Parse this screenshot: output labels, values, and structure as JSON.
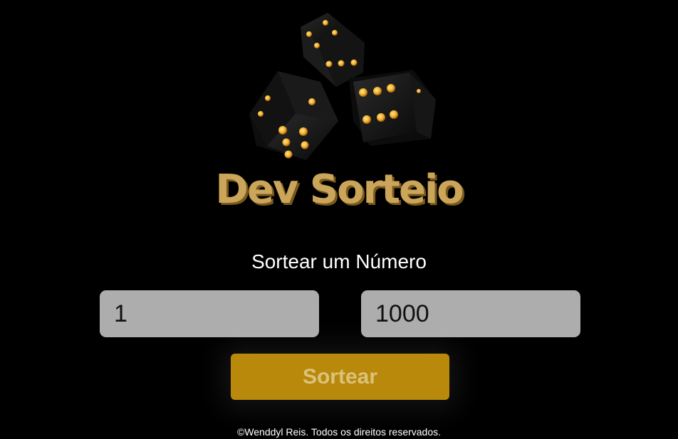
{
  "logo": {
    "text": "Dev Sorteio",
    "color": "#caa55a"
  },
  "art": {
    "icon": "dice-icon",
    "faces_shown": [
      4,
      5,
      6
    ]
  },
  "main": {
    "subtitle": "Sortear um Número",
    "min_value": "1",
    "max_value": "1000",
    "button_label": "Sortear",
    "button_color": "#b8890b"
  },
  "footer": {
    "text": "©Wenddyl Reis. Todos os direitos reservados."
  }
}
